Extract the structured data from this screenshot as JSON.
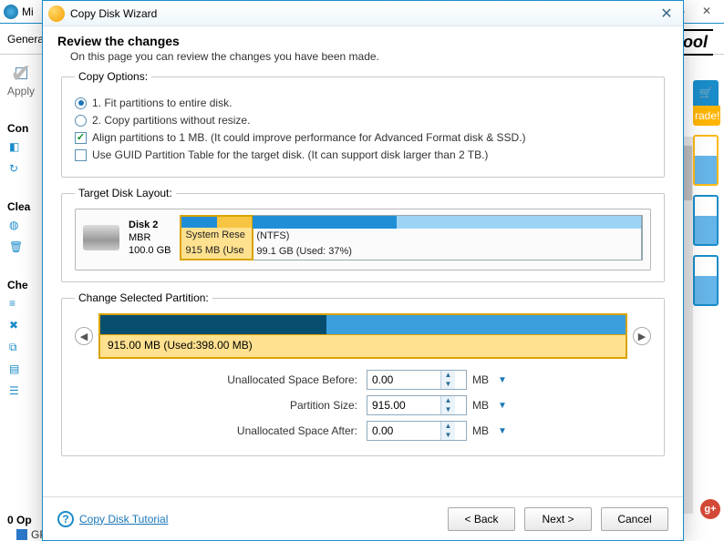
{
  "bg": {
    "title_prefix": "Mi",
    "toolbar_label": "Genera",
    "brand_suffix": "ool",
    "apply_label": "Apply",
    "grade_label": "rade!",
    "sections": [
      "Con",
      "Clea",
      "Che"
    ],
    "bottom_ops": "0 Op",
    "bottom_gpt": "GP"
  },
  "dialog": {
    "title": "Copy Disk Wizard",
    "heading": "Review the changes",
    "subheading": "On this page you can review the changes you have been made.",
    "groups": {
      "copy_options": {
        "legend": "Copy Options:",
        "opt1": "1. Fit partitions to entire disk.",
        "opt2": "2. Copy partitions without resize.",
        "align": "Align partitions to 1 MB.  (It could improve performance for Advanced Format disk & SSD.)",
        "guid": "Use GUID Partition Table for the target disk. (It can support disk larger than 2 TB.)",
        "selected_radio": 1,
        "align_checked": true,
        "guid_checked": false
      },
      "target_layout": {
        "legend": "Target Disk Layout:",
        "disk": {
          "name": "Disk 2",
          "style": "MBR",
          "size": "100.0 GB"
        },
        "partitions": [
          {
            "label_line1": "System Rese",
            "label_line2": "915 MB (Use",
            "used_pct": 50,
            "width_pct": 16,
            "selected": true
          },
          {
            "label_line1": "(NTFS)",
            "label_line2": "99.1 GB (Used: 37%)",
            "used_pct": 37,
            "width_pct": 84,
            "selected": false
          }
        ]
      },
      "change_partition": {
        "legend": "Change Selected Partition:",
        "bar_text": "915.00 MB (Used:398.00 MB)",
        "rows": {
          "before": {
            "label": "Unallocated Space Before:",
            "value": "0.00",
            "unit": "MB"
          },
          "size": {
            "label": "Partition Size:",
            "value": "915.00",
            "unit": "MB"
          },
          "after": {
            "label": "Unallocated Space After:",
            "value": "0.00",
            "unit": "MB"
          }
        }
      }
    },
    "footer": {
      "tutorial": "Copy Disk Tutorial",
      "back": "< Back",
      "next": "Next >",
      "cancel": "Cancel"
    }
  }
}
